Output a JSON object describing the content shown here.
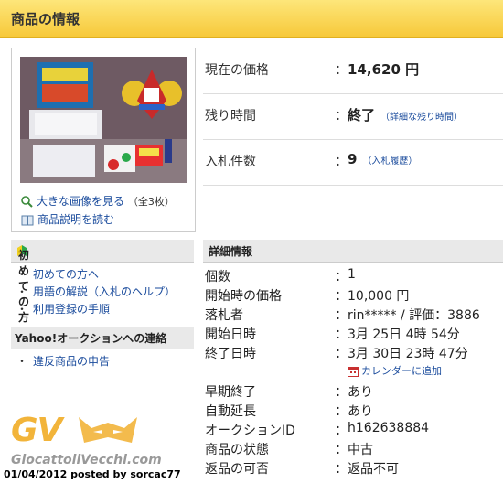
{
  "header": {
    "title": "商品の情報"
  },
  "thumbnail": {
    "enlarge_label": "大きな画像を見る",
    "enlarge_count": "（全3枚）",
    "description_label": "商品説明を読む"
  },
  "summary": {
    "price_label": "現在の価格",
    "price_value": "14,620 円",
    "time_label": "残り時間",
    "time_value": "終了",
    "time_detail": "（詳細な残り時間）",
    "bids_label": "入札件数",
    "bids_value": "9",
    "bids_history": "（入札履歴）",
    "colon": "："
  },
  "sidebar": {
    "beginners_title": "初めての方",
    "beginners_links": [
      "初めての方へ",
      "用語の解説（入札のヘルプ）",
      "利用登録の手順"
    ],
    "contact_title": "Yahoo!オークションへの連絡",
    "contact_links": [
      "違反商品の申告"
    ]
  },
  "details": {
    "title": "詳細情報",
    "rows": [
      {
        "label": "個数",
        "value": "1"
      },
      {
        "label": "開始時の価格",
        "value": "10,000 円"
      },
      {
        "label": "落札者",
        "value": "rin***** / 評価：3886"
      },
      {
        "label": "開始日時",
        "value": "3月 25日 4時 54分"
      },
      {
        "label": "終了日時",
        "value": "3月 30日 23時 47分"
      },
      {
        "label": "早期終了",
        "value": "あり"
      },
      {
        "label": "自動延長",
        "value": "あり"
      },
      {
        "label": "オークションID",
        "value": "h162638884"
      },
      {
        "label": "商品の状態",
        "value": "中古"
      },
      {
        "label": "返品の可否",
        "value": "返品不可"
      }
    ],
    "calendar_link": "カレンダーに追加"
  },
  "watermark": {
    "logo_text": "GV",
    "site": "GiocattoliVecchi.com",
    "posted": "01/04/2012 posted by sorcac77"
  },
  "colors": {
    "link": "#1a4b9c",
    "header_bg": "#f7c93a",
    "logo": "#f2b43a"
  }
}
